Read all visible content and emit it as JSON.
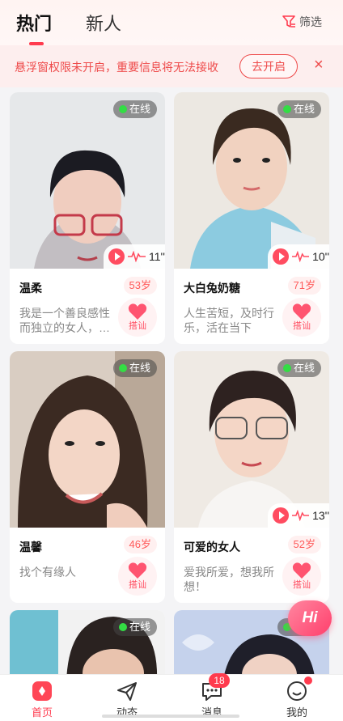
{
  "tabs": {
    "hot": "热门",
    "new": "新人"
  },
  "filter_label": "筛选",
  "notice": {
    "text": "悬浮窗权限未开启，重要信息将无法接收",
    "button": "去开启",
    "close": "×"
  },
  "online_label": "在线",
  "greet_label": "搭讪",
  "cards": [
    {
      "name": "温柔",
      "age": "53岁",
      "bio": "我是一个善良感性而独立的女人，…",
      "duration": "11''",
      "photo_colors": [
        "#e9ecef",
        "#c8c6c8"
      ]
    },
    {
      "name": "大白兔奶糖",
      "age": "71岁",
      "bio": "人生苦短，及时行乐，活在当下",
      "duration": "10''",
      "photo_colors": [
        "#eae6e0",
        "#cfd6da"
      ]
    },
    {
      "name": "温馨",
      "age": "46岁",
      "bio": "找个有缘人",
      "duration": "",
      "photo_colors": [
        "#ddd1c7",
        "#b8a897"
      ]
    },
    {
      "name": "可爱的女人",
      "age": "52岁",
      "bio": "爱我所爱，想我所想！",
      "duration": "13''",
      "photo_colors": [
        "#efe9e3",
        "#d9d2ca"
      ]
    }
  ],
  "partial_cards": [
    {
      "online": true,
      "photo_colors": [
        "#7bc4d4",
        "#f2f2f2"
      ]
    },
    {
      "online": true,
      "photo_colors": [
        "#b7c7e6",
        "#dfe6f4"
      ]
    }
  ],
  "hi_button": "Hi",
  "nav": [
    {
      "label": "首页",
      "icon": "home-icon",
      "active": true
    },
    {
      "label": "动态",
      "icon": "paper-plane-icon",
      "active": false
    },
    {
      "label": "消息",
      "icon": "chat-icon",
      "active": false
    },
    {
      "label": "我的",
      "icon": "profile-icon",
      "active": false
    }
  ],
  "message_badge": "18",
  "accent_color": "#ff3b4e"
}
